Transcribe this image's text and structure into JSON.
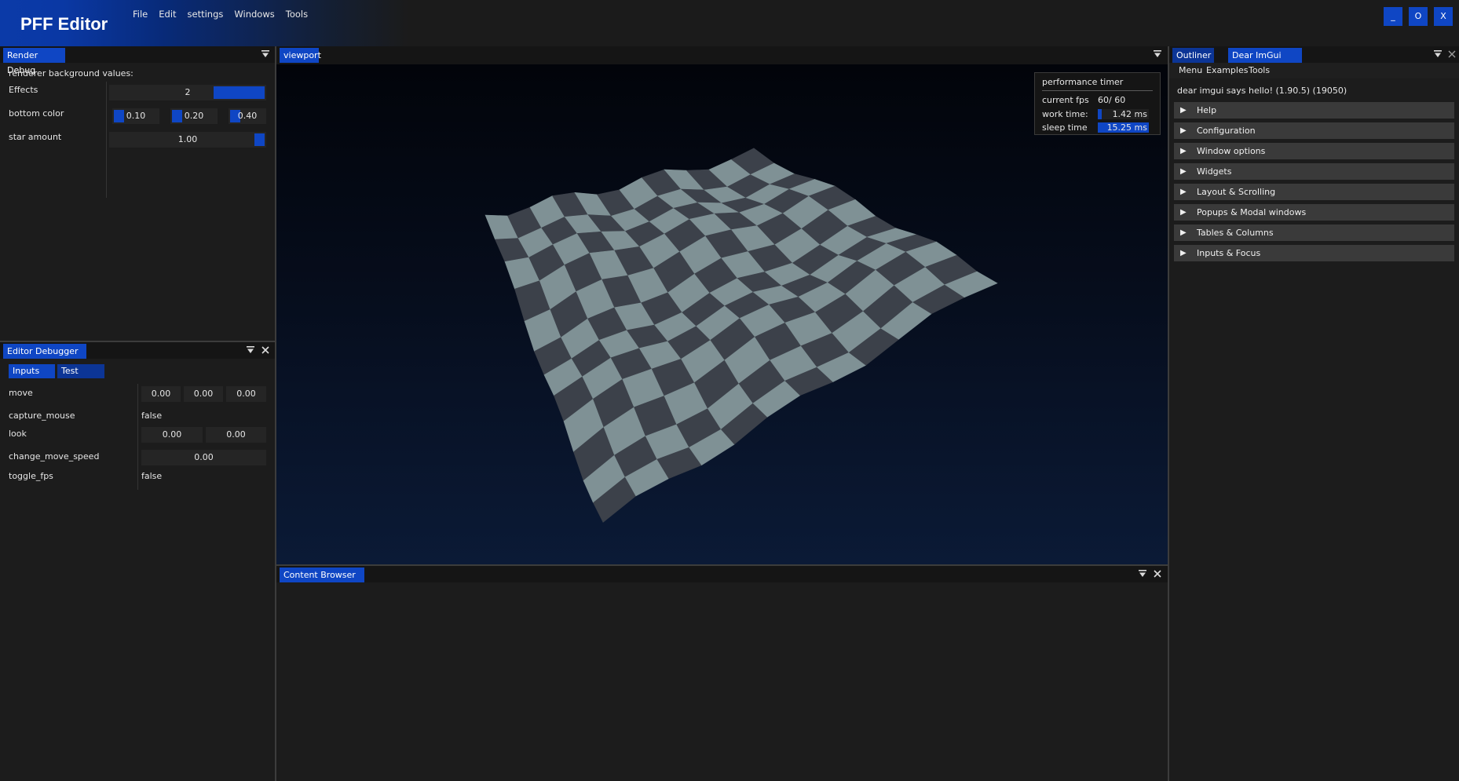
{
  "app": {
    "title": "PFF Editor",
    "menu": [
      "File",
      "Edit",
      "settings",
      "Windows",
      "Tools"
    ],
    "window_buttons": {
      "minimize": "_",
      "maximize": "O",
      "close": "X"
    }
  },
  "render_debug": {
    "tab": "Render Debug",
    "heading": "renderer background values:",
    "effects": {
      "label": "Effects",
      "value": "2"
    },
    "bottom_color": {
      "label": "bottom color",
      "r": "0.10",
      "g": "0.20",
      "b": "0.40"
    },
    "star_amount": {
      "label": "star amount",
      "value": "1.00"
    }
  },
  "editor_debugger": {
    "tab": "Editor Debugger",
    "subtabs": [
      "Inputs",
      "Test"
    ],
    "rows": {
      "move": {
        "label": "move",
        "x": "0.00",
        "y": "0.00",
        "z": "0.00"
      },
      "capture_mouse": {
        "label": "capture_mouse",
        "value": "false"
      },
      "look": {
        "label": "look",
        "x": "0.00",
        "y": "0.00"
      },
      "change_move_speed": {
        "label": "change_move_speed",
        "value": "0.00"
      },
      "toggle_fps": {
        "label": "toggle_fps",
        "value": "false"
      }
    }
  },
  "viewport": {
    "tab": "viewport",
    "perf": {
      "title": "performance timer",
      "fps_label": "current fps",
      "fps_value": "60/  60",
      "work_label": "work time:",
      "work_value": "1.42 ms",
      "work_fraction": 0.08,
      "sleep_label": "sleep time",
      "sleep_value": "15.25 ms",
      "sleep_fraction": 1.0
    },
    "mesh": {
      "light_color": "#7f9195",
      "dark_color": "#3c414a"
    }
  },
  "content_browser": {
    "tab": "Content Browser"
  },
  "right_panel": {
    "tabs": [
      "Outliner",
      "Dear ImGui Demo"
    ],
    "menu": [
      "Menu",
      "Examples",
      "Tools"
    ],
    "hello": "dear imgui says hello! (1.90.5) (19050)",
    "sections": [
      "Help",
      "Configuration",
      "Window options",
      "Widgets",
      "Layout & Scrolling",
      "Popups & Modal windows",
      "Tables & Columns",
      "Inputs & Focus"
    ]
  },
  "colors": {
    "accent": "#0f46c4",
    "panel_bg": "#1c1c1c",
    "field_bg": "#252525"
  }
}
